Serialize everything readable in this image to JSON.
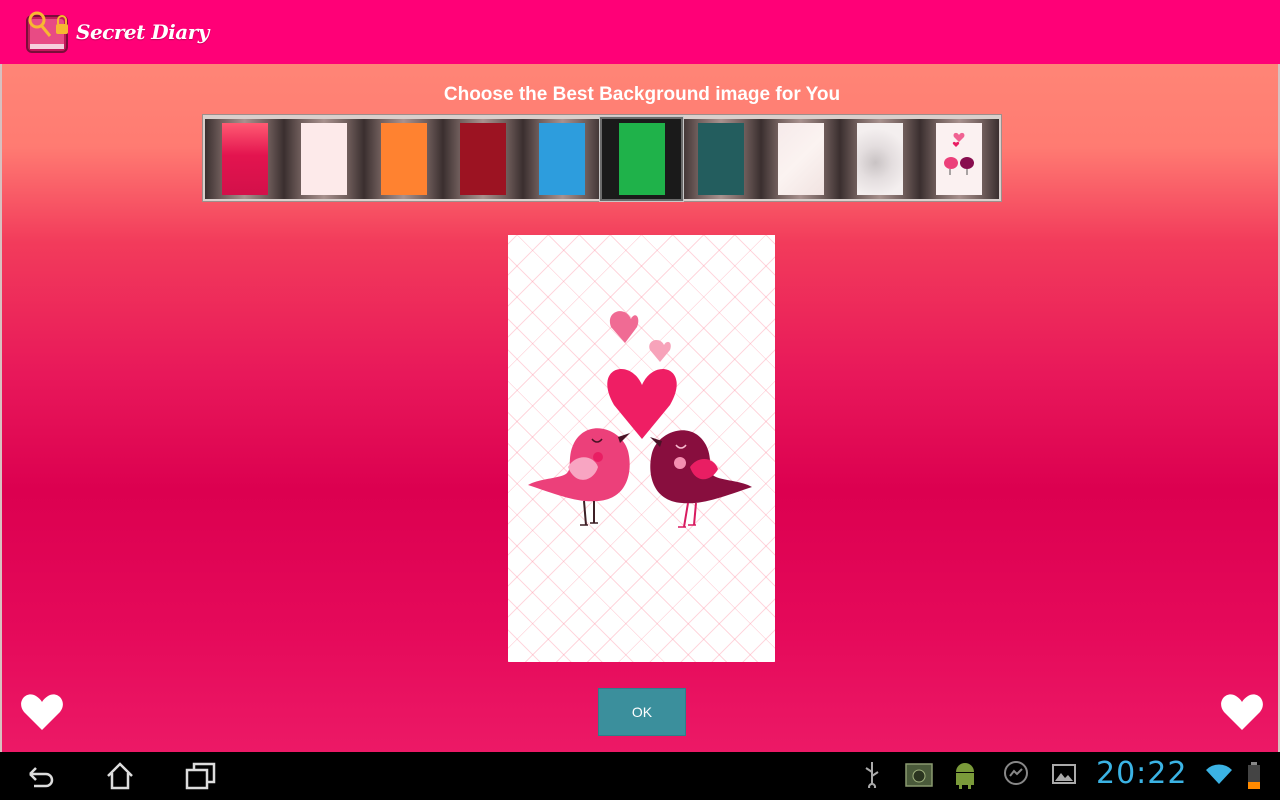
{
  "app": {
    "title": "Secret Diary"
  },
  "heading": "Choose the Best Background image for You",
  "thumbnails": [
    {
      "name": "pink-gradient",
      "selected": false
    },
    {
      "name": "blush",
      "selected": false
    },
    {
      "name": "orange",
      "selected": false
    },
    {
      "name": "crimson",
      "selected": false
    },
    {
      "name": "blue",
      "selected": false
    },
    {
      "name": "green",
      "selected": true
    },
    {
      "name": "teal",
      "selected": false
    },
    {
      "name": "paper",
      "selected": false
    },
    {
      "name": "glitter",
      "selected": false
    },
    {
      "name": "love-birds",
      "selected": false
    }
  ],
  "buttons": {
    "ok_label": "OK"
  },
  "icons": {
    "left_heart": "heart-icon",
    "right_heart": "heart-icon"
  },
  "status": {
    "time": "20:22"
  },
  "colors": {
    "accent": "#ff0077",
    "ok_button": "#3b8f9c",
    "clock": "#3bb3e4"
  }
}
